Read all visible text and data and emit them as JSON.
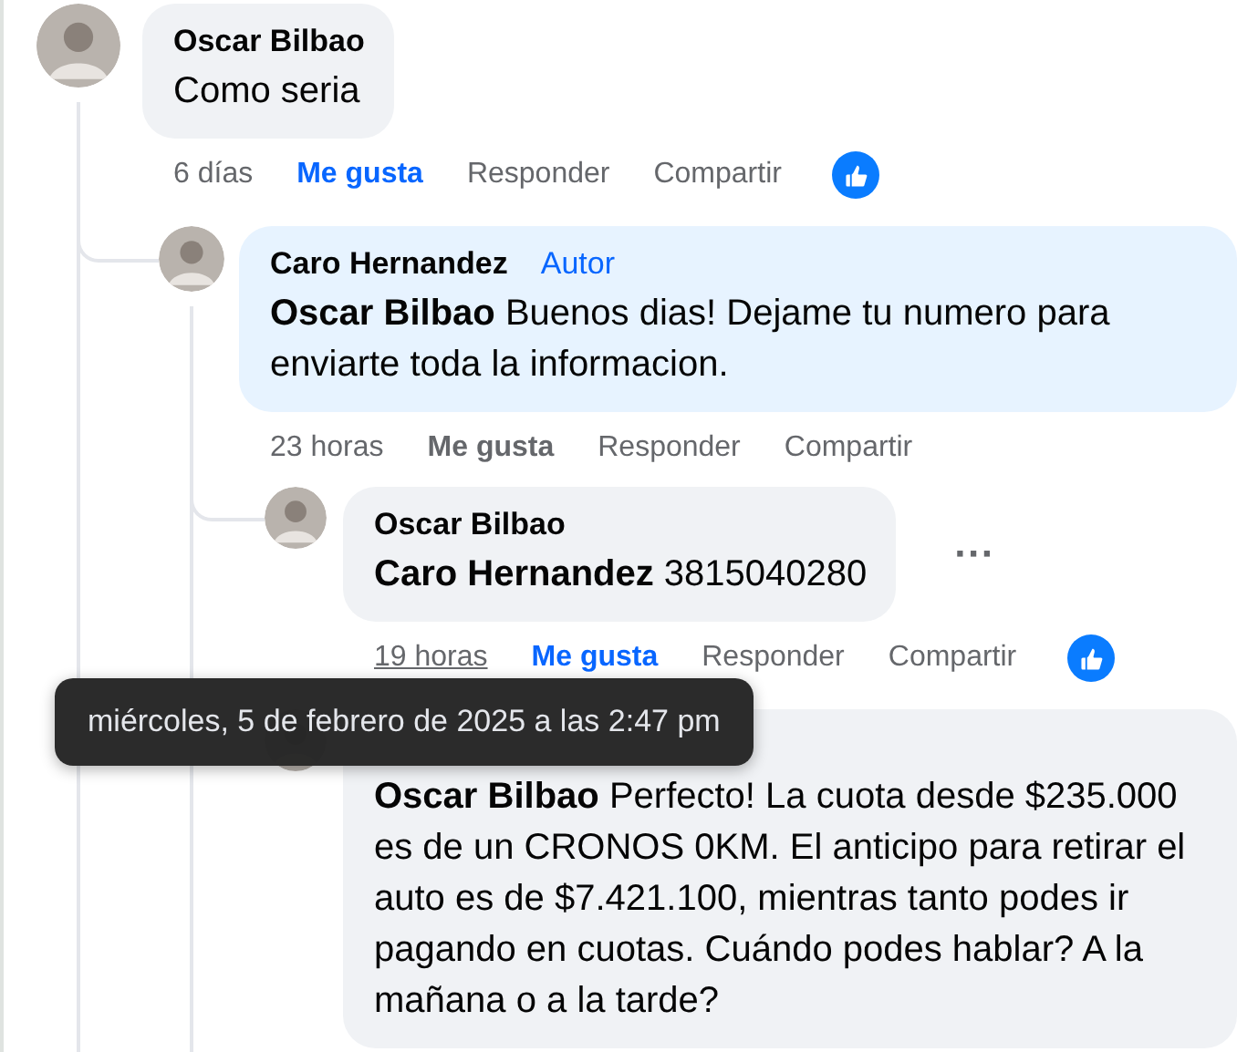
{
  "comments": [
    {
      "author": "Oscar Bilbao",
      "text": "Como seria",
      "time": "6 días",
      "time_hovered": false,
      "liked": true,
      "reaction_shown": true,
      "actions": [
        {
          "kind": "like",
          "label": "Me gusta"
        },
        {
          "kind": "reply",
          "label": "Responder"
        },
        {
          "kind": "share",
          "label": "Compartir"
        }
      ],
      "children": [
        {
          "author": "Caro Hernandez",
          "author_badge": "Autor",
          "text": "**Oscar Bilbao** Buenos dias! Dejame tu numero para enviarte toda la informacion.",
          "time": "23 horas",
          "time_hovered": false,
          "liked": false,
          "actions": [
            {
              "kind": "like",
              "label": "Me gusta"
            },
            {
              "kind": "reply",
              "label": "Responder"
            },
            {
              "kind": "share",
              "label": "Compartir"
            }
          ],
          "children": [
            {
              "author": "Oscar Bilbao",
              "text": "**Caro Hernandez** 3815040280",
              "more_label": "···",
              "time": "19 horas",
              "time_hovered": true,
              "liked": true,
              "reaction_shown": true,
              "actions": [
                {
                  "kind": "like",
                  "label": "Me gusta"
                },
                {
                  "kind": "reply",
                  "label": "Responder"
                },
                {
                  "kind": "share",
                  "label": "Compartir"
                }
              ]
            },
            {
              "text": "**Oscar Bilbao** Perfecto! La cuota desde $235.000 es de un CRONOS 0KM. El anticipo para retirar el auto es de $7.421.100, mientras tanto podes ir pagando en cuotas. Cuándo podes hablar? A la mañana o a la tarde?"
            }
          ]
        }
      ]
    }
  ],
  "tooltip": {
    "text": "miércoles, 5 de febrero de 2025 a las 2:47 pm"
  }
}
